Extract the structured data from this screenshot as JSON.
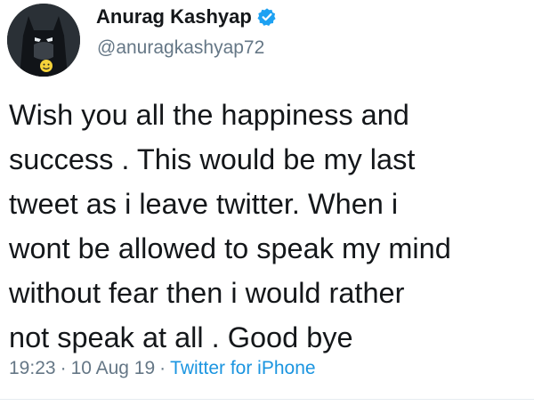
{
  "author": {
    "display_name": "Anurag Kashyap",
    "handle": "@anuragkashyap72",
    "verified": true,
    "avatar": "batman-avatar-icon"
  },
  "tweet": {
    "text": "Wish you all the happiness and\nsuccess . This would be my last\ntweet as i leave twitter. When i\nwont be allowed to speak my mind\nwithout fear then i would rather\nnot speak at all . Good bye",
    "time": "19:23",
    "date": "10 Aug 19",
    "source": "Twitter for iPhone",
    "separator": "·"
  },
  "colors": {
    "text": "#14171a",
    "secondary": "#657786",
    "link": "#1b95e0",
    "verified_badge": "#1da1f2"
  }
}
